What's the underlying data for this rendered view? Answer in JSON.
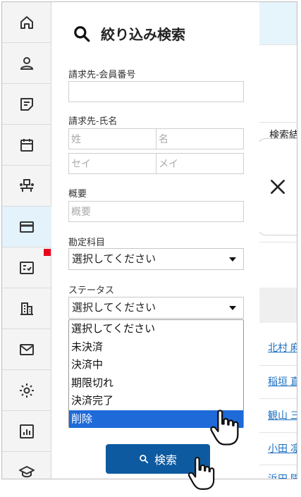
{
  "sidebar": {
    "items": [
      {
        "icon": "home-icon"
      },
      {
        "icon": "person-icon"
      },
      {
        "icon": "note-icon"
      },
      {
        "icon": "calendar-icon"
      },
      {
        "icon": "org-icon"
      },
      {
        "icon": "credit-card-icon"
      },
      {
        "icon": "checklist-icon"
      },
      {
        "icon": "building-icon"
      },
      {
        "icon": "mail-icon"
      },
      {
        "icon": "gear-icon"
      },
      {
        "icon": "report-icon"
      },
      {
        "icon": "graduation-cap-icon"
      }
    ],
    "active_index": 5,
    "notification_color": "#e8001c"
  },
  "panel": {
    "title": "絞り込み検索",
    "member_no_label": "請求先-会員番号",
    "member_no_value": "",
    "name_label": "請求先-氏名",
    "last_name_placeholder": "姓",
    "first_name_placeholder": "名",
    "last_kana_placeholder": "セイ",
    "first_kana_placeholder": "メイ",
    "summary_label": "概要",
    "summary_placeholder": "概要",
    "account_label": "勘定科目",
    "account_value": "選択してください",
    "status_label": "ステータス",
    "status_value": "選択してください",
    "status_options": [
      "選択してください",
      "未決済",
      "決済中",
      "期限切れ",
      "決済完了",
      "削除"
    ],
    "status_highlighted_index": 5,
    "search_button": "検索"
  },
  "background": {
    "search_results_label": "検索結",
    "names": [
      "北村 麻",
      "稲垣 直",
      "観山 三",
      "小田 凛",
      "浜田 陽"
    ]
  },
  "colors": {
    "accent": "#0e5aa0",
    "highlight": "#1e6ad8",
    "link": "#1a6fc0",
    "active_side_bg": "#e3f2fb"
  }
}
